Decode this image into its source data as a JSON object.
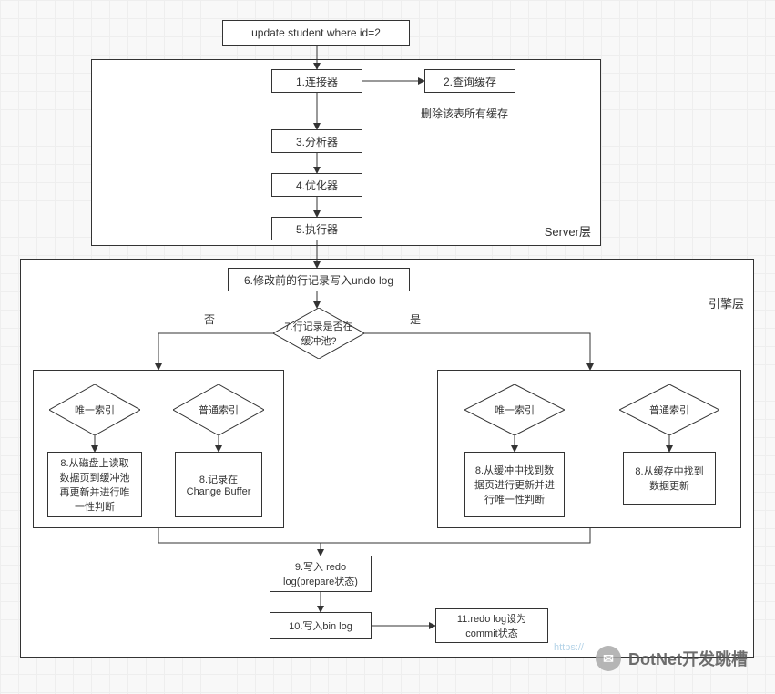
{
  "chart_data": {
    "type": "flowchart",
    "title": "",
    "start": "update student where id=2",
    "layers": [
      {
        "name": "Server层",
        "steps": [
          "1.连接器",
          "2.查询缓存",
          "3.分析器",
          "4.优化器",
          "5.执行器"
        ],
        "note": "删除该表所有缓存"
      },
      {
        "name": "引擎层",
        "steps": [
          "6.修改前的行记录写入undo log",
          "7.行记录是否在缓冲池?",
          "8",
          "9.写入 redo log(prepare状态)",
          "10.写入bin log",
          "11.redo log设为commit状态"
        ]
      }
    ],
    "decision": {
      "node": "7.行记录是否在缓冲池?",
      "no": {
        "label": "否",
        "branches": [
          {
            "index": "唯一索引",
            "action": "8.从磁盘上读取数据页到缓冲池再更新并进行唯一性判断"
          },
          {
            "index": "普通索引",
            "action": "8.记录在Change Buffer"
          }
        ]
      },
      "yes": {
        "label": "是",
        "branches": [
          {
            "index": "唯一索引",
            "action": "8.从缓冲中找到数据页进行更新并进行唯一性判断"
          },
          {
            "index": "普通索引",
            "action": "8.从缓存中找到数据更新"
          }
        ]
      }
    }
  },
  "nodes": {
    "start": "update student where id=2",
    "s1": "1.连接器",
    "s2": "2.查询缓存",
    "s2note": "删除该表所有缓存",
    "s3": "3.分析器",
    "s4": "4.优化器",
    "s5": "5.执行器",
    "serverLayer": "Server层",
    "engineLayer": "引擎层",
    "e6": "6.修改前的行记录写入undo log",
    "e7": "7.行记录是否在缓冲池?",
    "no": "否",
    "yes": "是",
    "idxUnique": "唯一索引",
    "idxNormal": "普通索引",
    "a8a": "8.从磁盘上读取数据页到缓冲池再更新并进行唯一性判断",
    "a8b": "8.记录在Change Buffer",
    "a8c": "8.从缓冲中找到数据页进行更新并进行唯一性判断",
    "a8d": "8.从缓存中找到数据更新",
    "e9": "9.写入 redo log(prepare状态)",
    "e10": "10.写入bin log",
    "e11": "11.redo log设为commit状态",
    "watermark": "DotNet开发跳槽",
    "wmlink": "https://"
  }
}
